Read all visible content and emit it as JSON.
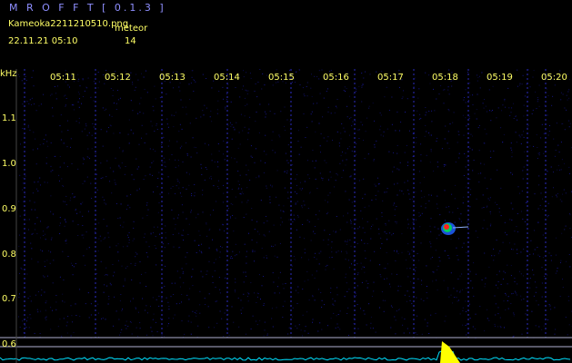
{
  "app": {
    "title": "M R O F F T  [ 0.1.3 ]"
  },
  "file": {
    "name": "Kameoka2211210510.png",
    "datetime": "22.11.21 05:10"
  },
  "meteor": {
    "label": "meteor",
    "count": "14"
  },
  "y_axis": {
    "unit": "kHz",
    "ticks": [
      "1.1",
      "1.0",
      "0.9",
      "0.8",
      "0.7",
      "0.6"
    ]
  },
  "x_axis": {
    "ticks": [
      "05:11",
      "05:12",
      "05:13",
      "05:14",
      "05:15",
      "05:16",
      "05:17",
      "05:18",
      "05:19",
      "05:20"
    ]
  },
  "colors": {
    "background": "#000000",
    "noise": "#1a1aa0",
    "label_text": "#ffff66",
    "title_text": "#8f8fff",
    "activity_trace": "#00e0ff",
    "peak_trace": "#ffff00",
    "echo_core": "#ff2020"
  }
}
